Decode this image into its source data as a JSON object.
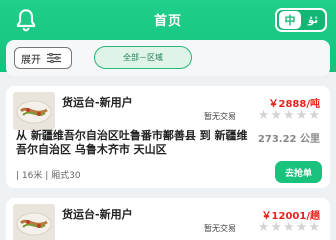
{
  "header": {
    "title": "首页",
    "lang_active": "中",
    "lang_alt": "ئۇ"
  },
  "filter": {
    "expand_label": "展开",
    "region_label": "全部－区域"
  },
  "cards": [
    {
      "title": "货运台-新用户",
      "price": "￥2888/吨",
      "trade_status": "暂无交易",
      "route": "从 新疆维吾尔自治区吐鲁番市鄯善县  到 新疆维吾尔自治区 乌鲁木齐市 天山区",
      "distance": "273.22 公里",
      "details": "| 16米  | 厢式30",
      "action": "去抢单"
    },
    {
      "title": "货运台-新用户",
      "price": "￥12001/趟",
      "trade_status": "暂无交易"
    }
  ],
  "colors": {
    "brand": "#19c27d",
    "price": "#e5241d"
  },
  "icons": {
    "bell": "bell-icon",
    "filter": "filter-lines-icon",
    "star": "star-icon"
  }
}
